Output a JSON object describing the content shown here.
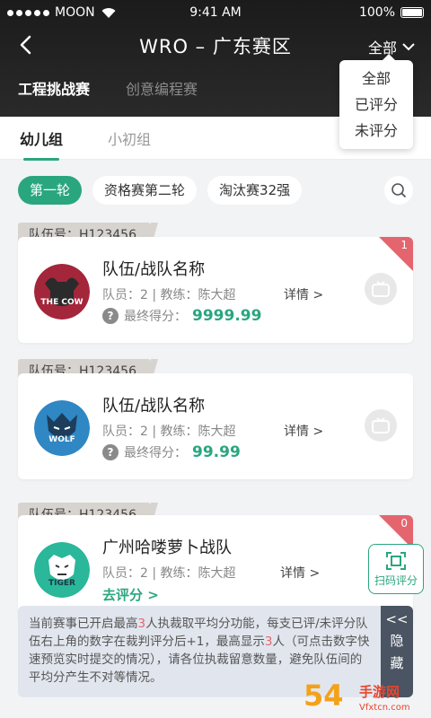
{
  "status_bar": {
    "carrier": "MOON",
    "time": "9:41 AM",
    "battery": "100%"
  },
  "header": {
    "title": "WRO – 广东赛区",
    "filter_label": "全部"
  },
  "top_tabs": [
    {
      "label": "工程挑战赛",
      "active": true
    },
    {
      "label": "创意编程赛",
      "active": false
    }
  ],
  "filter_menu": [
    "全部",
    "已评分",
    "未评分"
  ],
  "age_tabs": [
    {
      "label": "幼儿组",
      "active": true
    },
    {
      "label": "小初组",
      "active": false
    }
  ],
  "round_chips": [
    {
      "label": "第一轮",
      "active": true
    },
    {
      "label": "资格赛第二轮",
      "active": false
    },
    {
      "label": "淘汰赛32强",
      "active": false
    }
  ],
  "cards": [
    {
      "team_no": "队伍号：H123456",
      "name": "队伍/战队名称",
      "members": "队员：2  |  教练：陈大超",
      "details": "详情 >",
      "score_label": "最终得分：",
      "score": "9999.99",
      "badge": "1",
      "logo": "THE COW",
      "colors": {
        "logo": "#a4263a"
      }
    },
    {
      "team_no": "队伍号：H123456",
      "name": "队伍/战队名称",
      "members": "队员：2  |  教练：陈大超",
      "details": "详情 >",
      "score_label": "最终得分：",
      "score": "99.99",
      "logo": "WOLF",
      "colors": {
        "logo": "#2f87c4"
      }
    },
    {
      "team_no": "队伍号：H123456",
      "name": "广州哈喽萝卜战队",
      "members": "队员：2  |  教练：陈大超",
      "details": "详情 >",
      "action": "去评分 >",
      "badge": "0",
      "logo": "TIGER",
      "colors": {
        "logo": "#2ab79a"
      }
    }
  ],
  "scan_button": {
    "label": "扫码评分"
  },
  "notice": {
    "part1": "当前赛事已开启最高",
    "num1": "3",
    "part2": "人执裁取平均分功能，每支已评/未评分队伍右上角的数字在裁判评分后+1，最高显示",
    "num2": "3",
    "part3": "人（可点击数字快速预览实时提交的情况），请各位执裁留意数量，避免队伍间的平均分产生不对等情况。"
  },
  "hide_tab": {
    "arrow": "<<",
    "char1": "隐",
    "char2": "藏"
  },
  "watermark": {
    "digits": "54",
    "text": "手游网",
    "url": "Vfxtcn.com"
  },
  "colors": {
    "accent": "#2aa67f",
    "badge": "#e4656e",
    "header_bg": "#1b1b1b"
  }
}
